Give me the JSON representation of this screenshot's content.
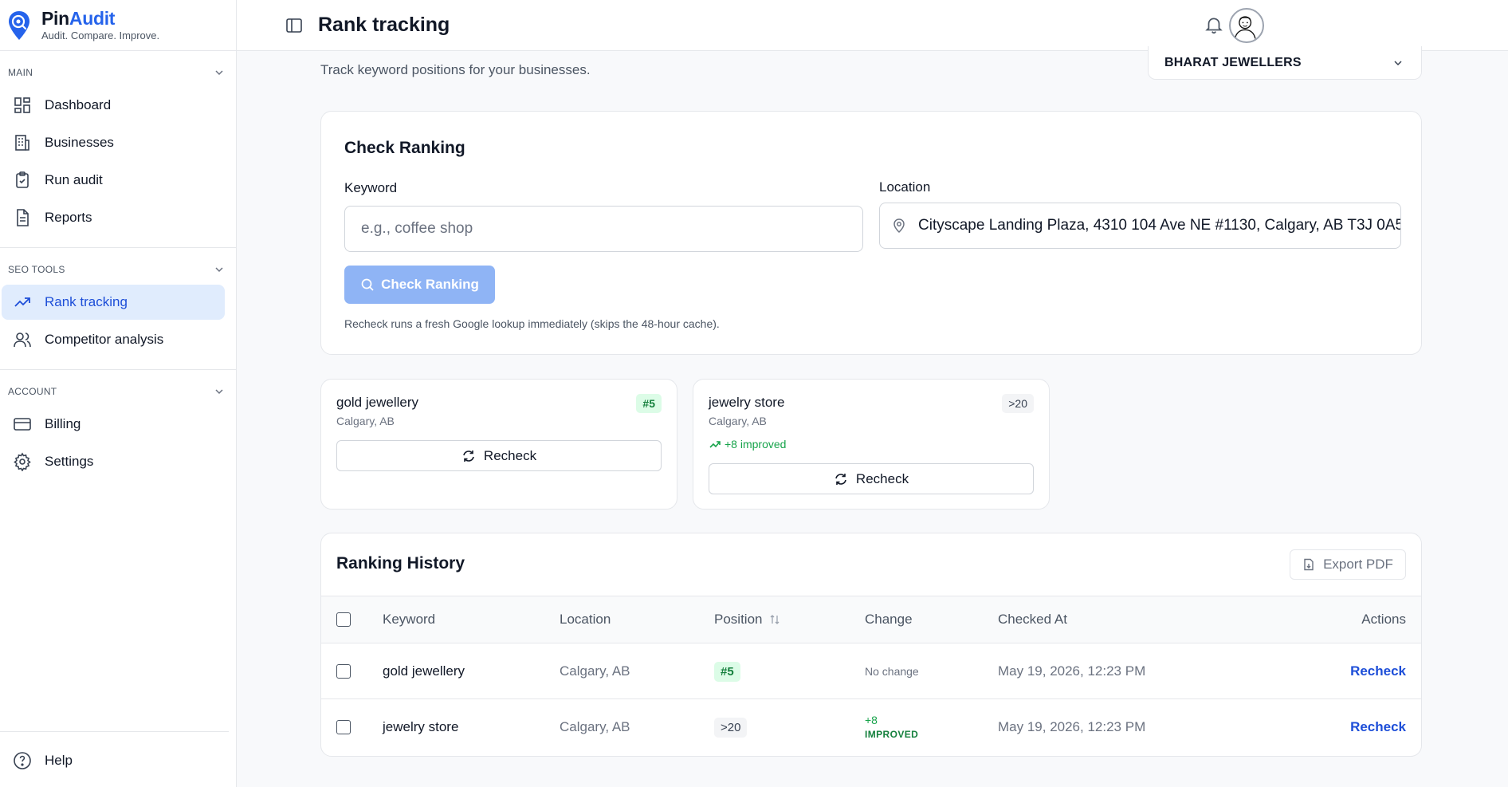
{
  "brand": {
    "name_part1": "Pin",
    "name_part2": "Audit",
    "tagline": "Audit. Compare. Improve."
  },
  "sidebar": {
    "sections": [
      {
        "title": "MAIN",
        "items": [
          {
            "label": "Dashboard",
            "icon": "dashboard-icon"
          },
          {
            "label": "Businesses",
            "icon": "building-icon"
          },
          {
            "label": "Run audit",
            "icon": "clipboard-check-icon"
          },
          {
            "label": "Reports",
            "icon": "file-text-icon"
          }
        ]
      },
      {
        "title": "SEO TOOLS",
        "items": [
          {
            "label": "Rank tracking",
            "icon": "trending-up-icon",
            "active": true
          },
          {
            "label": "Competitor analysis",
            "icon": "users-icon"
          }
        ]
      },
      {
        "title": "ACCOUNT",
        "items": [
          {
            "label": "Billing",
            "icon": "credit-card-icon"
          },
          {
            "label": "Settings",
            "icon": "gear-icon"
          }
        ]
      }
    ],
    "help_label": "Help"
  },
  "header": {
    "title": "Rank tracking"
  },
  "main": {
    "subtitle": "Track keyword positions for your businesses.",
    "business_select": "BHARAT JEWELLERS",
    "check": {
      "title": "Check Ranking",
      "keyword_label": "Keyword",
      "keyword_placeholder": "e.g., coffee shop",
      "location_label": "Location",
      "location_value": "Cityscape Landing Plaza, 4310 104 Ave NE #1130, Calgary, AB T3J 0A5",
      "button": "Check Ranking",
      "hint": "Recheck runs a fresh Google lookup immediately (skips the 48-hour cache)."
    },
    "keyword_cards": [
      {
        "keyword": "gold jewellery",
        "location": "Calgary, AB",
        "position": "#5",
        "improvement": "",
        "button": "Recheck"
      },
      {
        "keyword": "jewelry store",
        "location": "Calgary, AB",
        "position": ">20",
        "improvement": "+8 improved",
        "button": "Recheck"
      }
    ],
    "history": {
      "title": "Ranking History",
      "export_label": "Export PDF",
      "columns": [
        "Keyword",
        "Location",
        "Position",
        "Change",
        "Checked At",
        "Actions"
      ],
      "rows": [
        {
          "keyword": "gold jewellery",
          "location": "Calgary, AB",
          "position": "#5",
          "change": "No change",
          "change_label": "",
          "checked_at": "May 19, 2026, 12:23 PM",
          "action": "Recheck"
        },
        {
          "keyword": "jewelry store",
          "location": "Calgary, AB",
          "position": ">20",
          "change": "+8",
          "change_label": "IMPROVED",
          "checked_at": "May 19, 2026, 12:23 PM",
          "action": "Recheck"
        }
      ]
    }
  },
  "colors": {
    "accent": "#2563eb",
    "active_bg": "#e0ecfd",
    "success": "#16a34a",
    "button_disabled": "#8fb4f5"
  }
}
